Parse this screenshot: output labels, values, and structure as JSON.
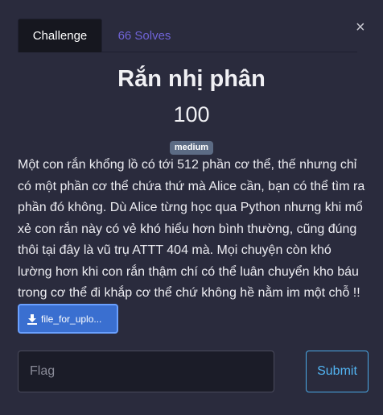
{
  "tabs": [
    {
      "label": "Challenge",
      "active": true
    },
    {
      "label": "66 Solves",
      "active": false
    }
  ],
  "close_label": "×",
  "challenge": {
    "name": "Rắn nhị phân",
    "value": "100",
    "difficulty": "medium",
    "description": "Một con rắn khổng lồ có tới 512 phần cơ thể, thế nhưng chỉ có một phần cơ thể chứa thứ mà Alice cần, bạn có thể tìm ra phần đó không. Dù Alice từng học qua Python nhưng khi mổ xẻ con rắn này có vẻ khó hiểu hơn bình thường, cũng đúng thôi tại đây là vũ trụ ATTT 404 mà. Mọi chuyện còn khó lường hơn khi con rắn thậm chí có thể luân chuyển kho báu trong cơ thể đi khắp cơ thể chứ không hề nằm im một chỗ !!"
  },
  "file": {
    "label": "file_for_uplo...",
    "icon": "download-icon"
  },
  "flag": {
    "placeholder": "Flag",
    "value": ""
  },
  "submit_label": "Submit",
  "colors": {
    "background": "#2a2b3d",
    "tab_active_bg": "#16171f",
    "tab_inactive_text": "#6f63d6",
    "badge_bg": "#5c6b84",
    "file_button_bg": "#3a6fd0",
    "submit_border": "#4aa8e6"
  }
}
